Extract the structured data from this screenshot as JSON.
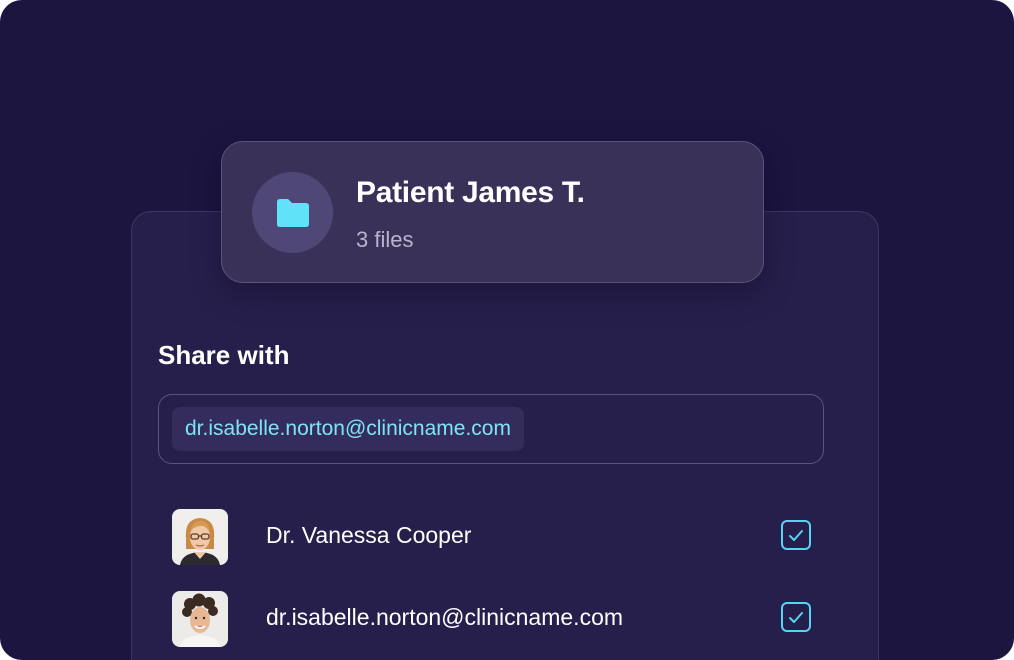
{
  "file_card": {
    "title": "Patient James T.",
    "subtitle": "3 files",
    "icon": "folder-icon"
  },
  "share": {
    "label": "Share with",
    "email_chip": "dr.isabelle.norton@clinicname.com"
  },
  "recipients": [
    {
      "name": "Dr. Vanessa Cooper",
      "checked": true,
      "avatar": "avatar-photo"
    },
    {
      "name": "dr.isabelle.norton@clinicname.com",
      "checked": true,
      "avatar": "avatar-photo"
    }
  ],
  "colors": {
    "background": "#1b1540",
    "panel": "#261f4c",
    "card": "#3a3159",
    "accent": "#55d6f0",
    "chip_text": "#7fe3f7"
  }
}
